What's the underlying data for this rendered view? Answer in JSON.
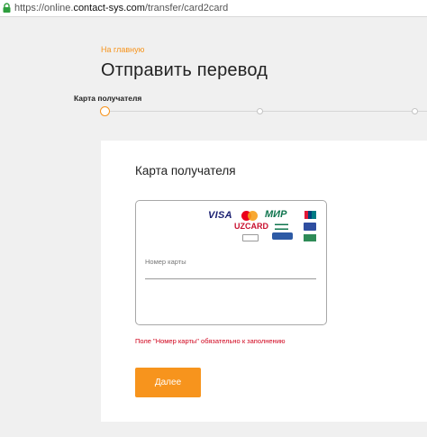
{
  "browser": {
    "url_prefix": "https://online.",
    "url_host": "contact-sys.com",
    "url_path": "/transfer/card2card"
  },
  "page": {
    "home_link": "На главную",
    "title": "Отправить перевод",
    "step_label": "Карта получателя"
  },
  "form": {
    "title": "Карта получателя",
    "card_field_label": "Номер карты",
    "card_field_value": "",
    "error": "Поле \"Номер карты\" обязательно к заполнению",
    "submit_label": "Далее"
  },
  "logos": {
    "visa": "VISA",
    "mir": "МИР",
    "uzcard": "UZCARD"
  },
  "colors": {
    "accent": "#f7941d",
    "error": "#d0021b",
    "background": "#f0f0f0"
  },
  "icons": [
    "lock-icon"
  ]
}
